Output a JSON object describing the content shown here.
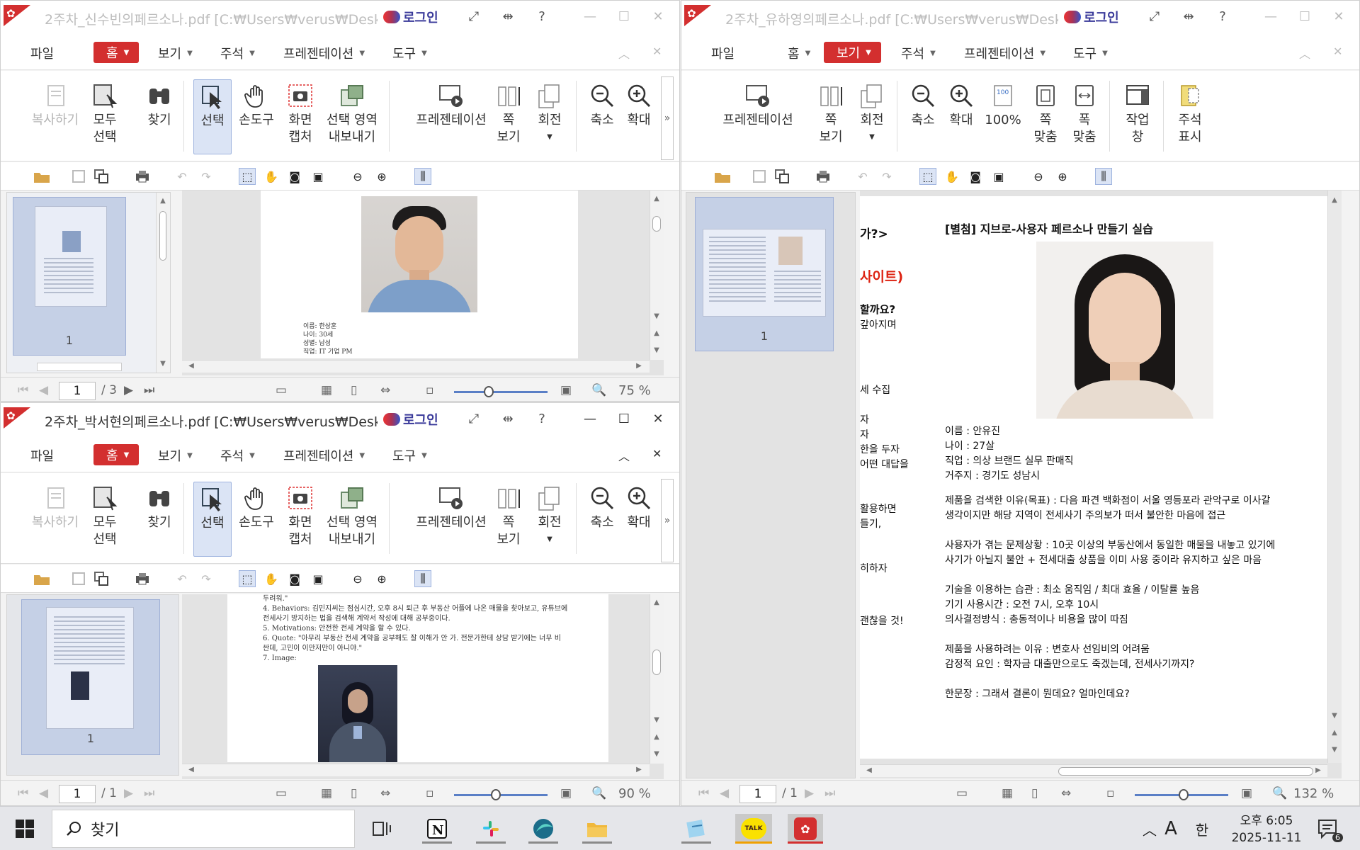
{
  "window1": {
    "title": "2주차_신수빈의페르소나.pdf [C:₩Users₩verus₩Deskt…",
    "login": "로그인",
    "menus": {
      "file": "파일",
      "home": "홈",
      "view": "보기",
      "annot": "주석",
      "present": "프레젠테이션",
      "tools": "도구"
    },
    "ribbon": {
      "copy": "복사하기",
      "select_all_1": "모두",
      "select_all_2": "선택",
      "find": "찾기",
      "select": "선택",
      "hand": "손도구",
      "capture_1": "화면",
      "capture_2": "캡처",
      "export_1": "선택 영역",
      "export_2": "내보내기",
      "presentation": "프레젠테이션",
      "pageview_1": "쪽",
      "pageview_2": "보기",
      "rotate": "회전",
      "zoomout": "축소",
      "zoomin": "확대"
    },
    "thumb_page": "1",
    "page_input": "1",
    "page_total": "/ 3",
    "zoom": "75 %",
    "zoom_level": 0.37,
    "doc_lines": [
      "이름: 한상훈",
      "나이: 30세",
      "성별: 남성",
      "직업: IT 기업 PM"
    ]
  },
  "window2": {
    "title": "2주차_유하영의페르소나.pdf [C:₩Users₩verus₩Deskt…",
    "login": "로그인",
    "menus": {
      "file": "파일",
      "home": "홈",
      "view": "보기",
      "annot": "주석",
      "present": "프레젠테이션",
      "tools": "도구"
    },
    "ribbon": {
      "presentation": "프레젠테이션",
      "pageview_1": "쪽",
      "pageview_2": "보기",
      "rotate": "회전",
      "zoomout": "축소",
      "zoomin": "확대",
      "actual": "100%",
      "fitpage_1": "쪽",
      "fitpage_2": "맞춤",
      "fitwidth_1": "폭",
      "fitwidth_2": "맞춤",
      "workpane_1": "작업",
      "workpane_2": "창",
      "annotshow_1": "주석",
      "annotshow_2": "표시"
    },
    "thumb_page": "1",
    "page_input": "1",
    "page_total": "/ 1",
    "zoom": "132 %",
    "zoom_level": 0.52,
    "left_fragments": [
      "가?>",
      "사이트)",
      "할까요?",
      "갚아지며",
      "세 수집",
      "자",
      "자",
      "한을 두자",
      "어떤 대답을",
      "활용하면",
      "들기,",
      "히하자",
      "괜찮을 것!"
    ],
    "heading": "[별첨] 지브로-사용자 페르소나 만들기 실습",
    "profile": [
      "이름 : 안유진",
      "나이 : 27살",
      "직업 : 의상 브랜드 실무 판매직",
      "거주지 : 경기도 성남시"
    ],
    "paras": [
      [
        "제품을 검색한 이유(목표) : 다음 파견 백화점이 서울 영등포라 관악구로 이사갈",
        "생각이지만 해당 지역이 전세사기 주의보가 떠서 불안한 마음에 접근"
      ],
      [
        "사용자가 겪는 문제상황 : 10곳 이상의 부동산에서 동일한 매물을 내놓고 있기에",
        "사기가 아닐지 불안 + 전세대출 상품을 이미 사용 중이라 유지하고 싶은 마음"
      ],
      [
        "기술을 이용하는 습관 : 최소 움직임 / 최대 효율 / 이탈률 높음",
        "기기 사용시간 : 오전 7시, 오후 10시",
        "의사결정방식 : 충동적이나 비용을 많이 따짐"
      ],
      [
        "제품을 사용하려는 이유 : 변호사 선임비의 어려움",
        "감정적 요인 : 학자금 대출만으로도 죽겠는데, 전세사기까지?"
      ],
      [
        "한문장 : 그래서 결론이 뭔데요? 얼마인데요?"
      ]
    ]
  },
  "window3": {
    "title": "2주차_박서현의페르소나.pdf [C:₩Users₩verus₩Deskt…",
    "login": "로그인",
    "menus": {
      "file": "파일",
      "home": "홈",
      "view": "보기",
      "annot": "주석",
      "present": "프레젠테이션",
      "tools": "도구"
    },
    "ribbon": {
      "copy": "복사하기",
      "select_all_1": "모두",
      "select_all_2": "선택",
      "find": "찾기",
      "select": "선택",
      "hand": "손도구",
      "capture_1": "화면",
      "capture_2": "캡처",
      "export_1": "선택 영역",
      "export_2": "내보내기",
      "presentation": "프레젠테이션",
      "pageview_1": "쪽",
      "pageview_2": "보기",
      "rotate": "회전",
      "zoomout": "축소",
      "zoomin": "확대"
    },
    "thumb_page": "1",
    "page_input": "1",
    "page_total": "/ 1",
    "zoom": "90 %",
    "zoom_level": 0.45,
    "doc_lines": [
      "두려워.\"",
      "4.  Behaviors: 김민지씨는 점심시간, 오후 8시 퇴근 후 부동산 어플에 나온 매물을 찾아보고, 유튜브에",
      "     전세사기 방지하는 법을 검색해 계약서 작성에 대해 공부중이다.",
      "5.  Motivations: 안전한 전세 계약을 할 수 있다.",
      "6.  Quote: \"아무리 부동산 전세 계약을 공부해도 잘 이해가 안 가. 전문가한테 상담 받기에는 너무 비",
      "     싼데, 고민이 이만저만이 아니야.\"",
      "7.  Image:"
    ]
  },
  "taskbar": {
    "search": "찾기",
    "ime_a": "A",
    "ime_han": "한",
    "time": "오후 6:05",
    "date": "2025-11-11",
    "notif": "6",
    "kakao": "TALK"
  },
  "colors": {
    "accent": "#d32f2f",
    "selection": "#dbe4f5",
    "zoom_track": "#5a7fc6"
  }
}
